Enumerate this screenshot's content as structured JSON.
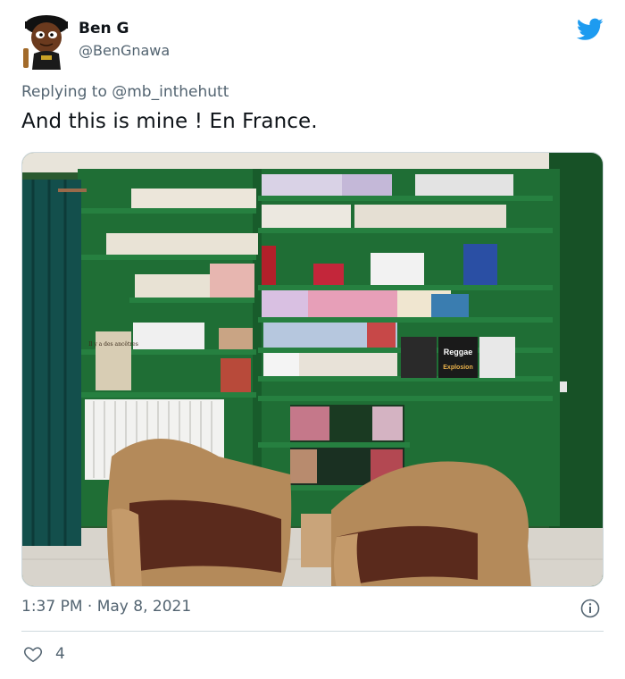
{
  "author": {
    "name": "Ben G",
    "handle": "@BenGnawa"
  },
  "reply": {
    "prefix": "Replying to ",
    "target": "@mb_inthehutt"
  },
  "tweet": {
    "text": "And this is mine ! En France."
  },
  "media": {
    "poster_top_line": "Reggae",
    "poster_bottom_line": "Explosion",
    "poster_left": "Il y a des ancêtres"
  },
  "meta": {
    "time": "1:37 PM",
    "separator": " · ",
    "date": "May 8, 2021"
  },
  "engagement": {
    "likes": "4"
  },
  "colors": {
    "brand_blue": "#1d9bf0",
    "secondary_text": "#536471",
    "shelf_green": "#1e6b33",
    "wall_green": "#1b5e2d"
  },
  "icons": {
    "brand": "twitter-bird-icon",
    "info": "info-icon",
    "like": "heart-icon"
  }
}
